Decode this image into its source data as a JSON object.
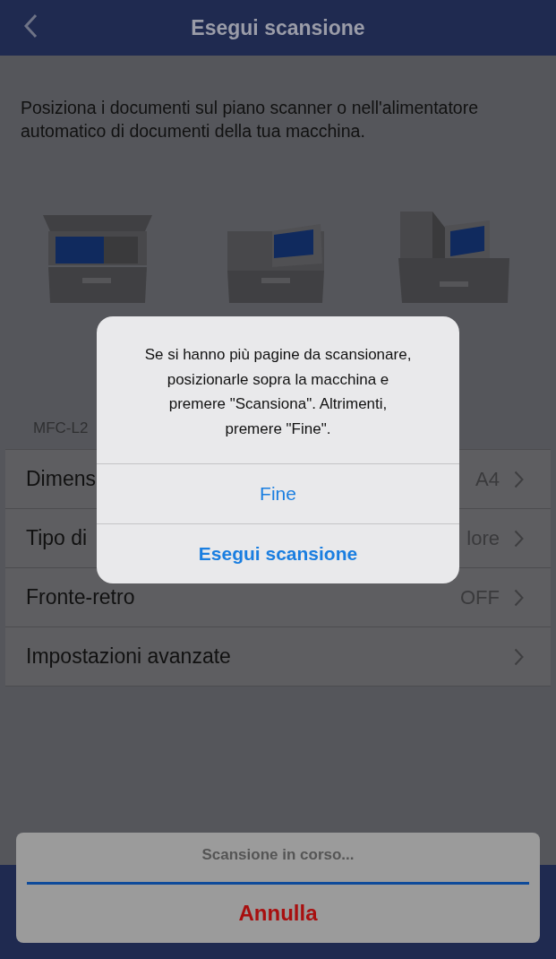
{
  "header": {
    "title": "Esegui scansione"
  },
  "instructions": "Posiziona i documenti sul piano scanner o nell'alimentatore automatico di documenti della tua macchina.",
  "device_label": "MFC-L2",
  "settings": [
    {
      "label": "Dimens",
      "value": "A4"
    },
    {
      "label": "Tipo di",
      "value": "lore"
    },
    {
      "label": "Fronte-retro",
      "value": "OFF"
    },
    {
      "label": "Impostazioni avanzate"
    }
  ],
  "alert": {
    "message_lines": [
      "Se si hanno più pagine da scansionare,",
      "posizionarle sopra la macchina e",
      "premere \"Scansiona\".  Altrimenti,",
      "premere \"Fine\"."
    ],
    "buttons": [
      {
        "label": "Fine",
        "bold": false
      },
      {
        "label": "Esegui scansione",
        "bold": true
      }
    ]
  },
  "progress_sheet": {
    "status": "Scansione in corso...",
    "cancel": "Annulla"
  }
}
